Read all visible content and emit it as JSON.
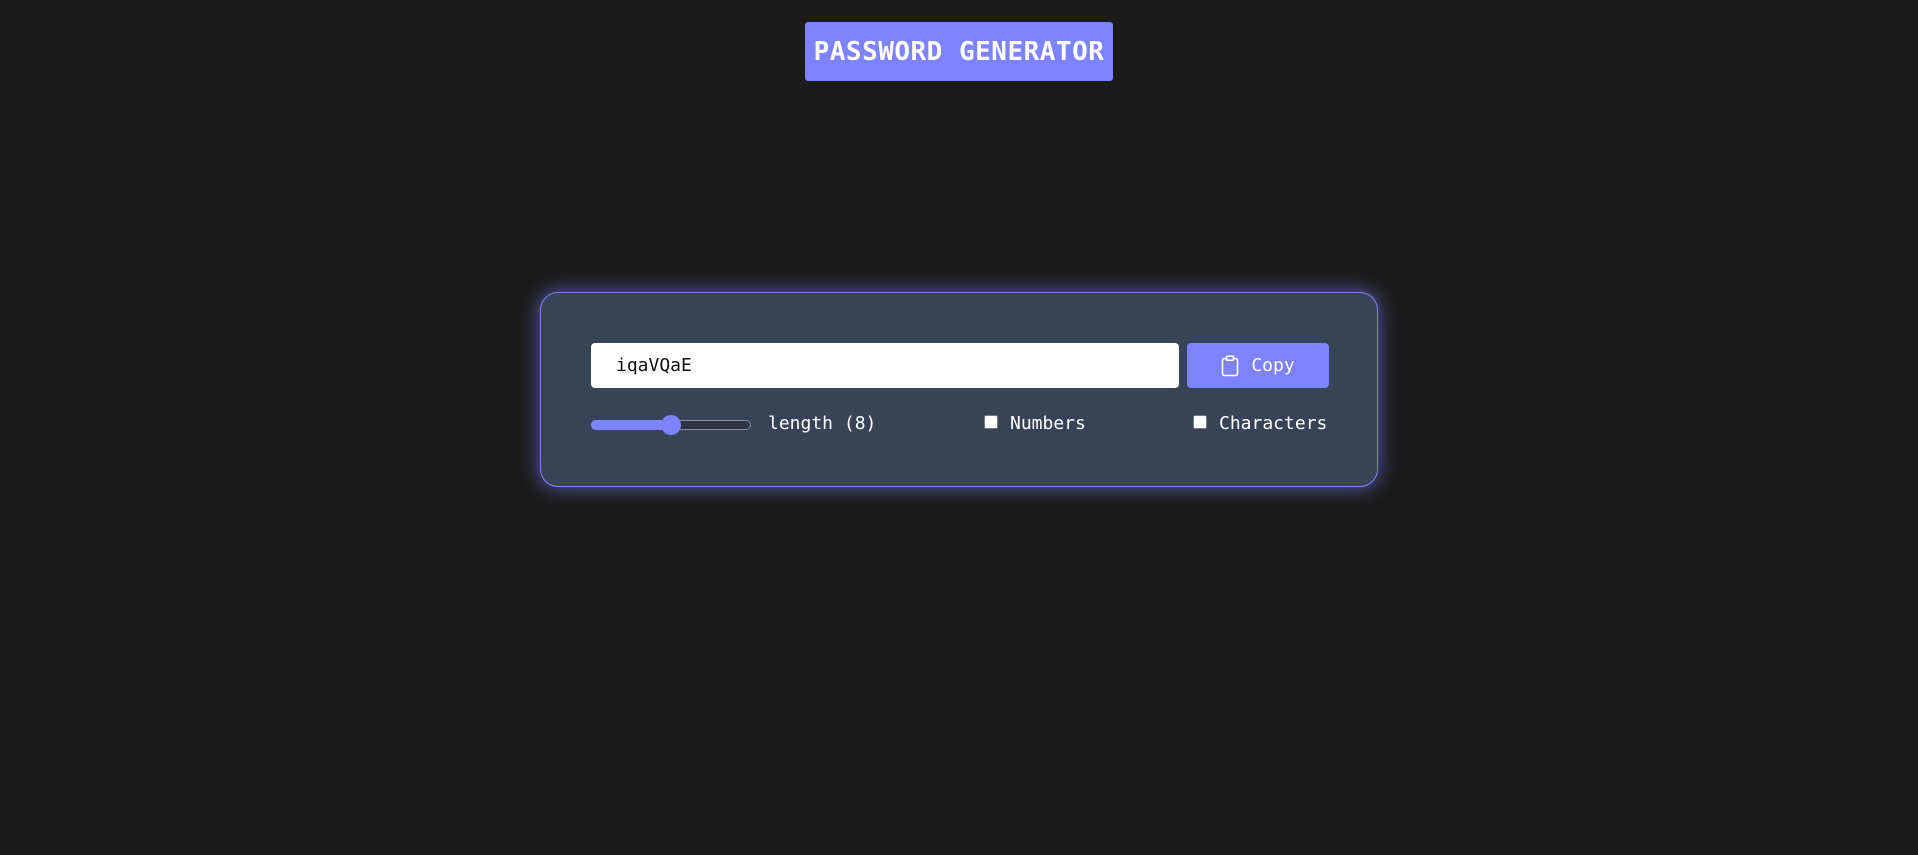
{
  "header": {
    "title": "PASSWORD GENERATOR"
  },
  "generator": {
    "password_value": "iqaVQaE",
    "copy_label": "Copy",
    "copy_icon": "clipboard-icon",
    "length_label": "length (8)",
    "length_value": 8,
    "length_fill_fraction": 0.5,
    "options": [
      {
        "label": "Numbers",
        "checked": false
      },
      {
        "label": "Characters",
        "checked": false
      }
    ]
  },
  "colors": {
    "background": "#1b1b1b",
    "card": "#374357",
    "accent": "#7c83fd",
    "text": "#ffffff"
  }
}
